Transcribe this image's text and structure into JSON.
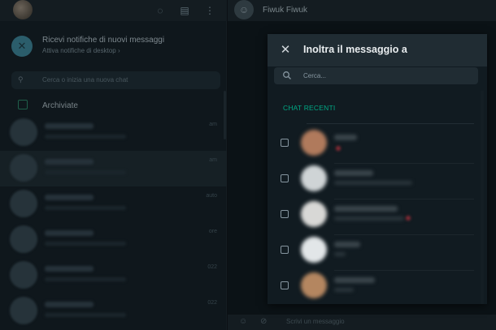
{
  "sidebar": {
    "notification": {
      "title": "Ricevi notifiche di nuovi messaggi",
      "subtitle": "Attiva notifiche di desktop ›"
    },
    "search_placeholder": "Cerca o inizia una nuova chat",
    "archived_label": "Archiviate",
    "chats": [
      {
        "time": "am"
      },
      {
        "time": "am"
      },
      {
        "time": "auto"
      },
      {
        "time": "ore"
      },
      {
        "time": "022"
      },
      {
        "time": "022"
      }
    ]
  },
  "conversation": {
    "contact_name": "Fiwuk Fiwuk",
    "composer_placeholder": "Scrivi un messaggio"
  },
  "forward_modal": {
    "title": "Inoltra il messaggio a",
    "search_placeholder": "Cerca...",
    "section_label": "CHAT RECENTI",
    "contacts": [
      {
        "avatar_color": "#b07a5c"
      },
      {
        "avatar_color": "#cfd4d6"
      },
      {
        "avatar_color": "#d8d8d6"
      },
      {
        "avatar_color": "#e2e6e8"
      },
      {
        "avatar_color": "#b48660"
      }
    ]
  },
  "colors": {
    "accent": "#00a884",
    "modal_bg": "#111b21",
    "modal_header_bg": "#202c33"
  },
  "icons": {
    "close": "close-icon",
    "search": "search-icon",
    "checkbox": "checkbox-icon"
  }
}
